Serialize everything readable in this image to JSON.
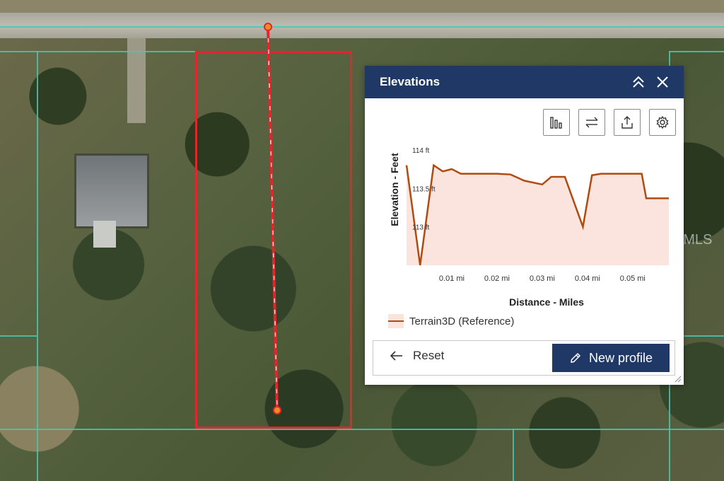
{
  "panel": {
    "title": "Elevations",
    "toolbar": {
      "stats_icon": "bar-chart-icon",
      "swap_icon": "swap-arrows-icon",
      "export_icon": "export-icon",
      "settings_icon": "gear-icon"
    },
    "reset_label": "Reset",
    "new_profile_label": "New profile"
  },
  "watermark": "Stellar MLS",
  "colors": {
    "header": "#1f3866",
    "parcel": "#e3262b",
    "profile_line": "#b14a0f",
    "profile_fill": "#fbe4dd",
    "parcel_grid": "#43c9b5"
  },
  "chart_data": {
    "type": "area",
    "xlabel": "Distance - Miles",
    "ylabel": "Elevation - Feet",
    "xlim": [
      0,
      0.058
    ],
    "ylim": [
      112.5,
      114.1
    ],
    "x_ticks": [
      0.01,
      0.02,
      0.03,
      0.04,
      0.05
    ],
    "x_tick_labels": [
      "0.01 mi",
      "0.02 mi",
      "0.03 mi",
      "0.04 mi",
      "0.05 mi"
    ],
    "y_ticks": [
      113,
      113.5,
      114
    ],
    "y_tick_labels": [
      "113 ft",
      "113.5 ft",
      "114 ft"
    ],
    "grid": false,
    "series": [
      {
        "name": "Terrain3D (Reference)",
        "x": [
          0,
          0.003,
          0.006,
          0.008,
          0.01,
          0.012,
          0.02,
          0.023,
          0.026,
          0.03,
          0.032,
          0.035,
          0.039,
          0.041,
          0.043,
          0.052,
          0.053,
          0.058
        ],
        "y": [
          113.8,
          112.5,
          113.8,
          113.72,
          113.75,
          113.69,
          113.69,
          113.68,
          113.6,
          113.55,
          113.65,
          113.65,
          113.0,
          113.67,
          113.69,
          113.69,
          113.37,
          113.37
        ]
      }
    ]
  }
}
